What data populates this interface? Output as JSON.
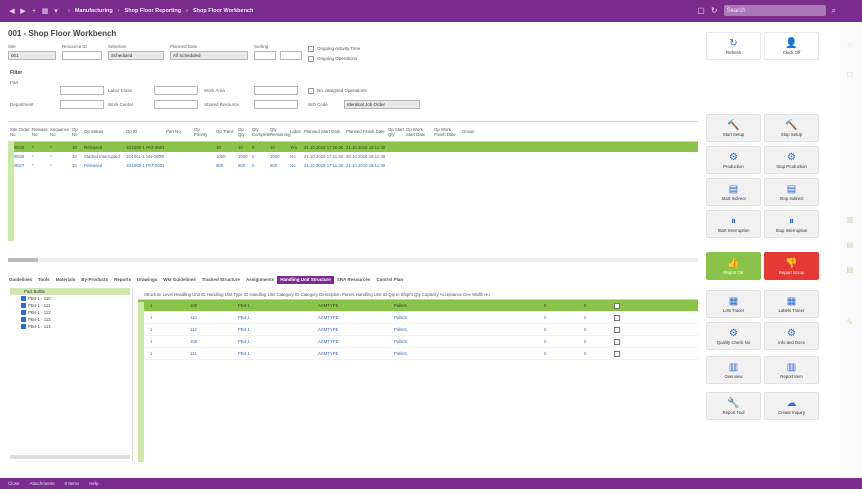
{
  "titlebar": {
    "breadcrumbs": [
      "Manufacturing",
      "Shop Floor Reporting",
      "Shop Floor Workbench"
    ],
    "search_placeholder": "Search",
    "bg_color": "#7b2d8e"
  },
  "page_title": "001 - Shop Floor Workbench",
  "filters": {
    "site_label": "Site",
    "site_value": "001",
    "resource_label": "Resource ID",
    "selection_label": "Selection",
    "selection_value": "Scheduled",
    "planned_label": "Planned Date",
    "planned_value": "All Scheduled",
    "sorting_label": "Sorting",
    "ongoing_label": "Ongoing Activity Time",
    "ongoing_ops_label": "Ongoing Operations",
    "filter_header": "Filter",
    "part_label": "Part",
    "labor_class_label": "Labor Class",
    "work_area_label": "Work Area",
    "unassigned_label": "No. assigned Operations",
    "department_label": "Department",
    "work_center_label": "Work Center",
    "shared_resource_label": "Shared Resource",
    "wo_code_label": "WO Code",
    "wo_code_value": "Identical Job Order"
  },
  "grid": {
    "columns": [
      "Site Order No",
      "Release No",
      "Sequence No",
      "Op No",
      "Op Status",
      "Op ID",
      "Part No",
      "Op Priority",
      "Op Trans",
      "Op Qty",
      "Qty Complete",
      "Qty Remaining",
      "Labor",
      "Planned Start Date",
      "Planned Finish Date",
      "Op Start Qty",
      "Op Work Start Date",
      "Op Work Finish Date",
      "Group"
    ],
    "rows": [
      [
        "800025",
        "*",
        "*",
        "10",
        "Released",
        "1D1000-1 PAT-0001",
        "",
        "",
        "10",
        "10",
        "0",
        "10",
        "Yes",
        "21.10.2019 17:00:00",
        "21.10.2019 18:11:30",
        "",
        "",
        "",
        ""
      ],
      [
        "800026",
        "*",
        "*",
        "10",
        "Started Interrupted",
        "1D1001-1 SN-0000071-01",
        "",
        "",
        "1000",
        "1000",
        "0",
        "1000",
        "No",
        "21.10.2019 17:11:30",
        "28.10.2019 18:11:30",
        "",
        "",
        "",
        ""
      ],
      [
        "800027",
        "*",
        "*",
        "10",
        "Released",
        "1D1000-1 PAT-0001",
        "",
        "",
        "800",
        "800",
        "0",
        "800",
        "No",
        "21.10.2019 17:11:30",
        "21.10.2019 18:11:30",
        "",
        "",
        "",
        ""
      ]
    ]
  },
  "tabs": [
    "Guidelines",
    "Tools",
    "Materials",
    "By-Products",
    "Reports",
    "Drawings",
    "Wkt Guidelines",
    "Tracked Structure",
    "Assignments",
    "Handling Unit Structure",
    "SRA Resources",
    "Control Plan"
  ],
  "active_tab": "Handling Unit Structure",
  "tree": {
    "header": "Part Bottle",
    "items": [
      "PB4-1 - 110",
      "PB4-1 - 111",
      "PB4-1 - 112",
      "PB4-1 - 113",
      "PB4-1 - 114"
    ]
  },
  "subgrid": {
    "header_text": "Structure Level  Handling Unit ID  Handling Unit Type ID  Handling Unit Category ID  Category Description  Parent Handling Unit ID  Qty in Shipm  Qty Capacity  Acceptance Dev  Width  Hu",
    "rows": [
      [
        "1",
        "108",
        "PB4-1",
        "ASMTYPE",
        "Pallets",
        "0",
        "0"
      ],
      [
        "1",
        "110",
        "PB4-1",
        "ASMTYPE",
        "Pallets",
        "0",
        "0"
      ],
      [
        "1",
        "112",
        "PB4-1",
        "ASMTYPE",
        "Pallets",
        "0",
        "0"
      ],
      [
        "1",
        "109",
        "PB4-1",
        "ASMTYPE",
        "Pallets",
        "0",
        "0"
      ],
      [
        "1",
        "111",
        "PB4-1",
        "ASMTYPE",
        "Pallets",
        "0",
        "0"
      ]
    ]
  },
  "buttons": [
    {
      "label": "Refresh",
      "icon": "↻",
      "name": "refresh-button",
      "style": "white"
    },
    {
      "label": "Clock Off",
      "icon": "👤",
      "name": "clock-off-button",
      "style": "white"
    },
    {
      "label": "Start Setup",
      "icon": "🔨",
      "name": "start-setup-button",
      "style": "light"
    },
    {
      "label": "Stop Setup",
      "icon": "🔨",
      "name": "stop-setup-button",
      "style": "light"
    },
    {
      "label": "Production",
      "icon": "⚙",
      "name": "production-button",
      "style": "light"
    },
    {
      "label": "Stop Production",
      "icon": "⚙",
      "name": "stop-production-button",
      "style": "light"
    },
    {
      "label": "Start Indirect",
      "icon": "▤",
      "name": "start-indirect-button",
      "style": "light"
    },
    {
      "label": "Stop Indirect",
      "icon": "▤",
      "name": "stop-indirect-button",
      "style": "light"
    },
    {
      "label": "Start Interruption",
      "icon": "⏸",
      "name": "start-interruption-button",
      "style": "light"
    },
    {
      "label": "Stop Interruption",
      "icon": "⏸",
      "name": "stop-interruption-button",
      "style": "light"
    },
    {
      "label": "Report OK",
      "icon": "👍",
      "name": "report-ok-button",
      "style": "green"
    },
    {
      "label": "Report Scrap",
      "icon": "👎",
      "name": "report-scrap-button",
      "style": "red"
    },
    {
      "label": "Lots Tracer",
      "icon": "▦",
      "name": "lots-tracer-button",
      "style": "light"
    },
    {
      "label": "Labels Tracer",
      "icon": "▦",
      "name": "labels-tracer-button",
      "style": "light"
    },
    {
      "label": "Quality Check No",
      "icon": "⚙",
      "name": "quality-check-button",
      "style": "light"
    },
    {
      "label": "Info and Docs",
      "icon": "⚙",
      "name": "info-docs-button",
      "style": "light"
    },
    {
      "label": "Overview",
      "icon": "▥",
      "name": "overview-button",
      "style": "light"
    },
    {
      "label": "Report Item",
      "icon": "▥",
      "name": "report-item-button",
      "style": "light"
    },
    {
      "label": "Report Tool",
      "icon": "🔧",
      "name": "report-tool-button",
      "style": "light"
    },
    {
      "label": "Create Inquiry",
      "icon": "☁",
      "name": "create-inquiry-button",
      "style": "light"
    }
  ],
  "status_bar": [
    "Close",
    "Attachments",
    "0 Items",
    "Help"
  ]
}
